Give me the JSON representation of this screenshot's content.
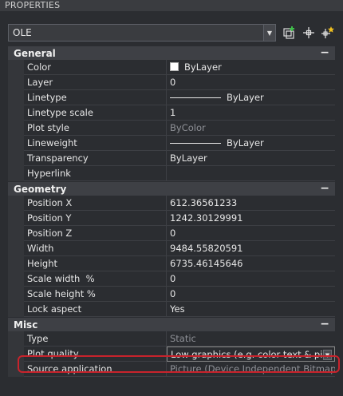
{
  "window": {
    "title": "PROPERTIES"
  },
  "object_selector": {
    "value": "OLE"
  },
  "toolbar": {
    "icons": [
      "toggle-pickadd-icon",
      "select-objects-icon",
      "quick-select-icon"
    ]
  },
  "sections": {
    "general": {
      "title": "General",
      "toggle": "−",
      "rows": [
        {
          "name": "Color",
          "value": "ByLayer"
        },
        {
          "name": "Layer",
          "value": "0"
        },
        {
          "name": "Linetype",
          "value": "ByLayer"
        },
        {
          "name": "Linetype scale",
          "value": "1"
        },
        {
          "name": "Plot style",
          "value": "ByColor"
        },
        {
          "name": "Lineweight",
          "value": "ByLayer"
        },
        {
          "name": "Transparency",
          "value": "ByLayer"
        },
        {
          "name": "Hyperlink",
          "value": ""
        }
      ]
    },
    "geometry": {
      "title": "Geometry",
      "toggle": "−",
      "rows": [
        {
          "name": "Position X",
          "value": "612.36561233"
        },
        {
          "name": "Position Y",
          "value": "1242.30129991"
        },
        {
          "name": "Position Z",
          "value": "0"
        },
        {
          "name": "Width",
          "value": "9484.55820591"
        },
        {
          "name": "Height",
          "value": "6735.46145646"
        },
        {
          "name": "Scale width  %",
          "value": "0"
        },
        {
          "name": "Scale height %",
          "value": "0"
        },
        {
          "name": "Lock aspect",
          "value": "Yes"
        }
      ]
    },
    "misc": {
      "title": "Misc",
      "toggle": "−",
      "rows": [
        {
          "name": "Type",
          "value": "Static"
        },
        {
          "name": "Plot quality",
          "value": "Low graphics (e.g. color text & pi..."
        },
        {
          "name": "Source application",
          "value": "Picture (Device Independent Bitmap)"
        }
      ]
    }
  },
  "colors": {
    "highlight": "#c8232c",
    "background": "#2b2d31"
  }
}
